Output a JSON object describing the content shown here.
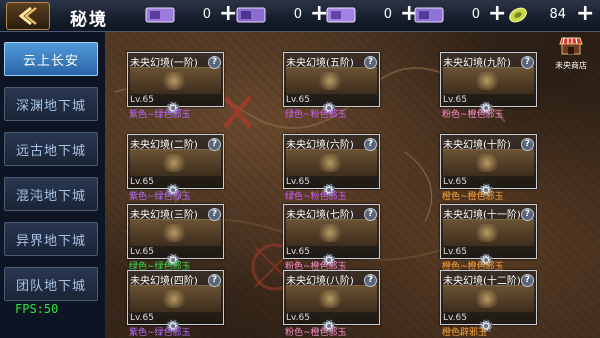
{
  "header": {
    "title": "秘境",
    "resources": [
      {
        "icon": "ticket-icon",
        "value": "0",
        "color": "#c6a7ff"
      },
      {
        "icon": "ticket-icon",
        "value": "0",
        "color": "#b99cff"
      },
      {
        "icon": "ticket-icon",
        "value": "0",
        "color": "#d0b0ff"
      },
      {
        "icon": "ticket-icon",
        "value": "0",
        "color": "#b8a0f0"
      }
    ],
    "coin": {
      "icon": "coin-icon",
      "value": "84"
    },
    "plus_label": "+"
  },
  "sidebar": {
    "items": [
      {
        "label": "云上长安",
        "active": true
      },
      {
        "label": "深渊地下城"
      },
      {
        "label": "远古地下城"
      },
      {
        "label": "混沌地下城"
      },
      {
        "label": "异界地下城"
      },
      {
        "label": "团队地下城"
      }
    ],
    "fps": "FPS:50"
  },
  "shop": {
    "label": "未央商店"
  },
  "colors": {
    "reward_green": "#38e04a",
    "reward_purple": "#d05cff",
    "reward_pink": "#ff6fcf",
    "reward_orange": "#ffa53a"
  },
  "dungeons": [
    {
      "name": "未央幻境(一阶)",
      "level": "Lv.65",
      "reward": "紫色~绿色邪玉",
      "reward_color": "#b86bff"
    },
    {
      "name": "未央幻境(二阶)",
      "level": "Lv.65",
      "reward": "紫色~绿色邪玉",
      "reward_color": "#b86bff"
    },
    {
      "name": "未央幻境(三阶)",
      "level": "Lv.65",
      "reward": "绿色~绿色邪玉",
      "reward_color": "#38e04a"
    },
    {
      "name": "未央幻境(四阶)",
      "level": "Lv.65",
      "reward": "紫色~绿色邪玉",
      "reward_color": "#b86bff"
    },
    {
      "name": "未央幻境(五阶)",
      "level": "Lv.65",
      "reward": "绿色~粉色邪玉",
      "reward_color": "#d05cff"
    },
    {
      "name": "未央幻境(六阶)",
      "level": "Lv.65",
      "reward": "绿色~粉色邪玉",
      "reward_color": "#d05cff"
    },
    {
      "name": "未央幻境(七阶)",
      "level": "Lv.65",
      "reward": "粉色~橙色邪玉",
      "reward_color": "#ff8fd0"
    },
    {
      "name": "未央幻境(八阶)",
      "level": "Lv.65",
      "reward": "粉色~橙色邪玉",
      "reward_color": "#ff8fd0"
    },
    {
      "name": "未央幻境(九阶)",
      "level": "Lv.65",
      "reward": "粉色~橙色邪玉",
      "reward_color": "#ff8fd0"
    },
    {
      "name": "未央幻境(十阶)",
      "level": "Lv.65",
      "reward": "橙色~橙色邪玉",
      "reward_color": "#ffa53a"
    },
    {
      "name": "未央幻境(十一阶)",
      "level": "Lv.65",
      "reward": "橙色~橙色邪玉",
      "reward_color": "#ffa53a"
    },
    {
      "name": "未央幻境(十二阶)",
      "level": "Lv.65",
      "reward": "橙色辟邪玉",
      "reward_color": "#ffa53a"
    }
  ]
}
